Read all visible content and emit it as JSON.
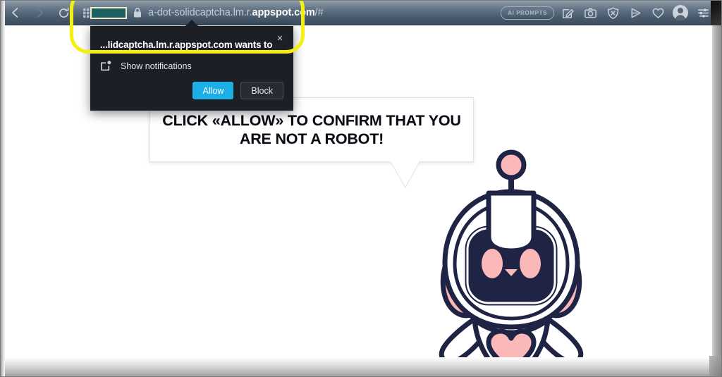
{
  "browser": {
    "nav": {
      "back_label": "Back",
      "forward_label": "Forward",
      "reload_label": "Reload",
      "apps_label": "Apps"
    },
    "address_bar": {
      "redacted_block": "",
      "url_prefix": "a-dot-solidcaptcha.lm.r.",
      "url_domain": "appspot.com",
      "url_suffix": "/#",
      "lock_state": "secure"
    },
    "toolbar_right": {
      "ai_prompts_label": "AI PROMPTS",
      "icons": [
        "edit-note-icon",
        "camera-icon",
        "shield-block-icon",
        "send-icon",
        "heart-icon",
        "avatar-icon",
        "settings-sliders-icon"
      ]
    }
  },
  "dialog": {
    "title": "...lidcaptcha.lm.r.appspot.com wants to",
    "close_label": "×",
    "permission_icon": "notification-icon",
    "permission_label": "Show notifications",
    "allow_label": "Allow",
    "block_label": "Block",
    "allow_color": "#1cafe6",
    "background_color": "#1c1f26"
  },
  "page": {
    "bubble": {
      "line1": "CLICK «ALLOW» TO CONFIRM THAT YOU",
      "line2": "ARE NOT A ROBOT!"
    },
    "mascot": {
      "name": "robot-mascot",
      "outline_color": "#1f2445",
      "accent_color": "#fbb8b8",
      "screen_color": "#1f2445"
    }
  },
  "annotation": {
    "highlight_color": "#f5ee11",
    "shape": "rounded-rectangle"
  }
}
